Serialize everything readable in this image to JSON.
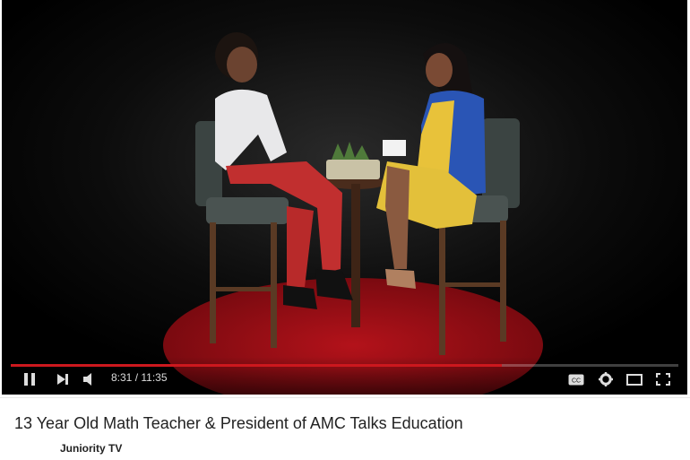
{
  "player": {
    "current_time": "8:31",
    "duration": "11:35",
    "time_display": "8:31 / 11:35",
    "progress_fraction": 0.735,
    "accent_color": "#cc181e",
    "controls": {
      "play_pause_icon": "pause-icon",
      "next_icon": "next-icon",
      "volume_icon": "volume-icon",
      "captions_icon": "captions-icon",
      "settings_icon": "gear-icon",
      "theater_icon": "theater-mode-icon",
      "fullscreen_icon": "fullscreen-icon"
    }
  },
  "video": {
    "title": "13 Year Old Math Teacher & President of AMC Talks Education",
    "channel_name": "Juniority TV"
  }
}
